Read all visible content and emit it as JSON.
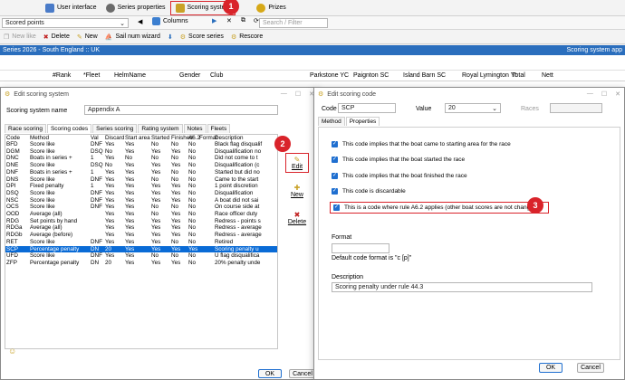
{
  "toolbar_tabs": [
    {
      "label": "User interface",
      "icon": "user-interface-icon",
      "color": "#4a7bc8"
    },
    {
      "label": "Series properties",
      "icon": "series-properties-icon",
      "color": "#6b6b6b"
    },
    {
      "label": "Scoring system",
      "icon": "scoring-system-icon",
      "color": "#c9a227"
    },
    {
      "label": "Prizes",
      "icon": "prizes-icon",
      "color": "#d6a817"
    }
  ],
  "badges": {
    "b1": "1",
    "b2": "2",
    "b3": "3"
  },
  "row2": {
    "scored_points": "Scored points",
    "columns_label": "Columns",
    "search_placeholder": "Search / Filter"
  },
  "row3": {
    "new_like": "New like",
    "delete": "Delete",
    "new": "New",
    "sail_num_wizard": "Sail num wizard",
    "score_series": "Score series",
    "rescore": "Rescore"
  },
  "series_title": "Series 2026 - South England :: UK",
  "series_right": "Scoring system app",
  "columns": [
    "#Rank",
    "*Fleet",
    "HelmName",
    "Gender",
    "Club",
    "Parkstone YC",
    "Paignton SC",
    "Island Barn SC",
    "Royal Lymington Yt",
    "Total",
    "Nett"
  ],
  "scoring_dialog": {
    "title": "Edit scoring system",
    "name_label": "Scoring system name",
    "name_value": "Appendix A",
    "tabs": [
      "Race scoring",
      "Scoring codes",
      "Series scoring",
      "Rating system",
      "Notes",
      "Fleets"
    ],
    "headers": [
      "Code",
      "Method",
      "Val",
      "Discard",
      "Start area",
      "Started",
      "Finished",
      "A6.2",
      "Format",
      "Description"
    ],
    "rows": [
      [
        "BFD",
        "Score like",
        "DNF",
        "Yes",
        "Yes",
        "No",
        "No",
        "No",
        "",
        "Black flag disqualif"
      ],
      [
        "DGM",
        "Score like",
        "DSQ",
        "No",
        "Yes",
        "Yes",
        "Yes",
        "No",
        "",
        "Disqualification no"
      ],
      [
        "DNC",
        "Boats in series +",
        "1",
        "Yes",
        "No",
        "No",
        "No",
        "No",
        "",
        "Did not come to t"
      ],
      [
        "DNE",
        "Score like",
        "DSQ",
        "No",
        "Yes",
        "Yes",
        "Yes",
        "No",
        "",
        "Disqualification (c"
      ],
      [
        "DNF",
        "Boats in series +",
        "1",
        "Yes",
        "Yes",
        "Yes",
        "No",
        "No",
        "",
        "Started but did no"
      ],
      [
        "DNS",
        "Score like",
        "DNF",
        "Yes",
        "Yes",
        "No",
        "No",
        "No",
        "",
        "Came to the start"
      ],
      [
        "DPI",
        "Fixed penalty",
        "1",
        "Yes",
        "Yes",
        "Yes",
        "Yes",
        "No",
        "",
        "1 point discretion"
      ],
      [
        "DSQ",
        "Score like",
        "DNF",
        "Yes",
        "Yes",
        "Yes",
        "Yes",
        "No",
        "",
        "Disqualification"
      ],
      [
        "NSC",
        "Score like",
        "DNF",
        "Yes",
        "Yes",
        "Yes",
        "Yes",
        "No",
        "",
        "A boat did not sai"
      ],
      [
        "OCS",
        "Score like",
        "DNF",
        "Yes",
        "Yes",
        "No",
        "No",
        "No",
        "",
        "On course side at"
      ],
      [
        "OOD",
        "Average (all)",
        "",
        "Yes",
        "Yes",
        "No",
        "Yes",
        "No",
        "",
        "Race officer duty"
      ],
      [
        "RDG",
        "Set points by hand",
        "",
        "Yes",
        "Yes",
        "Yes",
        "Yes",
        "No",
        "",
        "Redress - points s"
      ],
      [
        "RDGa",
        "Average (all)",
        "",
        "Yes",
        "Yes",
        "Yes",
        "Yes",
        "No",
        "",
        "Redress - average"
      ],
      [
        "RDGb",
        "Average (before)",
        "",
        "Yes",
        "Yes",
        "Yes",
        "Yes",
        "No",
        "",
        "Redress - average"
      ],
      [
        "RET",
        "Score like",
        "DNF",
        "Yes",
        "Yes",
        "Yes",
        "No",
        "No",
        "",
        "Retired"
      ],
      [
        "SCP",
        "Percentage penalty",
        "DN",
        "20",
        "Yes",
        "Yes",
        "Yes",
        "Yes",
        "",
        "Scoring penalty u"
      ],
      [
        "UFD",
        "Score like",
        "DNF",
        "Yes",
        "Yes",
        "No",
        "No",
        "No",
        "",
        "U flag disqualifica"
      ],
      [
        "ZFP",
        "Percentage penalty",
        "DN",
        "20",
        "Yes",
        "Yes",
        "Yes",
        "No",
        "",
        "20% penalty unde"
      ]
    ],
    "selected_index": 15,
    "side_buttons": {
      "edit": "Edit",
      "new": "New",
      "delete": "Delete"
    },
    "ok": "OK",
    "cancel": "Cancel"
  },
  "code_dialog": {
    "title": "Edit scoring code",
    "code_label": "Code",
    "code_value": "SCP",
    "value_label": "Value",
    "value_value": "20",
    "races_label": "Races",
    "tabs": [
      "Method",
      "Properties"
    ],
    "checks": [
      "This code implies that the boat came to starting area for the race",
      "This code implies that the boat started the race",
      "This code implies that the boat finished the race",
      "This code is discardable",
      "This is a code where rule A6.2 applies (other boat scores are not changed)"
    ],
    "format_label": "Format",
    "format_value": "",
    "format_hint": "Default code format is \"c [p]\"",
    "description_label": "Description",
    "description_value": "Scoring penalty under rule 44.3",
    "ok": "OK",
    "cancel": "Cancel"
  },
  "colors": {
    "accent": "#2a6ebd",
    "highlight": "#d9232a",
    "selection": "#0a6bd6"
  }
}
